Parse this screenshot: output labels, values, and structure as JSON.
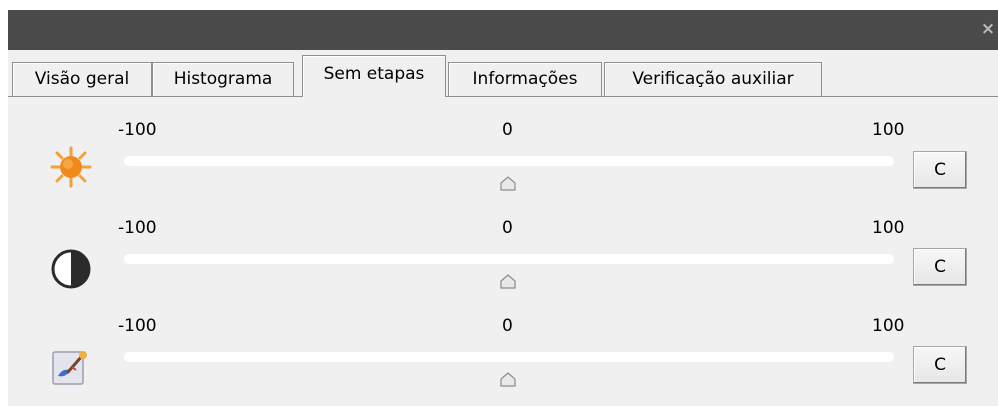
{
  "window": {
    "close_glyph": "×"
  },
  "tabs": [
    {
      "label": "Visão geral",
      "active": false
    },
    {
      "label": "Histograma",
      "active": false
    },
    {
      "label": "Sem etapas",
      "active": true
    },
    {
      "label": "Informações",
      "active": false
    },
    {
      "label": "Verificação auxiliar",
      "active": false
    }
  ],
  "sliders": [
    {
      "icon": "brightness-sun-icon",
      "min_label": "-100",
      "mid_label": "0",
      "max_label": "100",
      "value": 0,
      "reset_label": "C"
    },
    {
      "icon": "contrast-icon",
      "min_label": "-100",
      "mid_label": "0",
      "max_label": "100",
      "value": 0,
      "reset_label": "C"
    },
    {
      "icon": "saturation-paint-icon",
      "min_label": "-100",
      "mid_label": "0",
      "max_label": "100",
      "value": 0,
      "reset_label": "C"
    }
  ],
  "colors": {
    "titlebar": "#4b4b4b",
    "panel": "#f0f0f0",
    "sun": "#f28a1a"
  }
}
